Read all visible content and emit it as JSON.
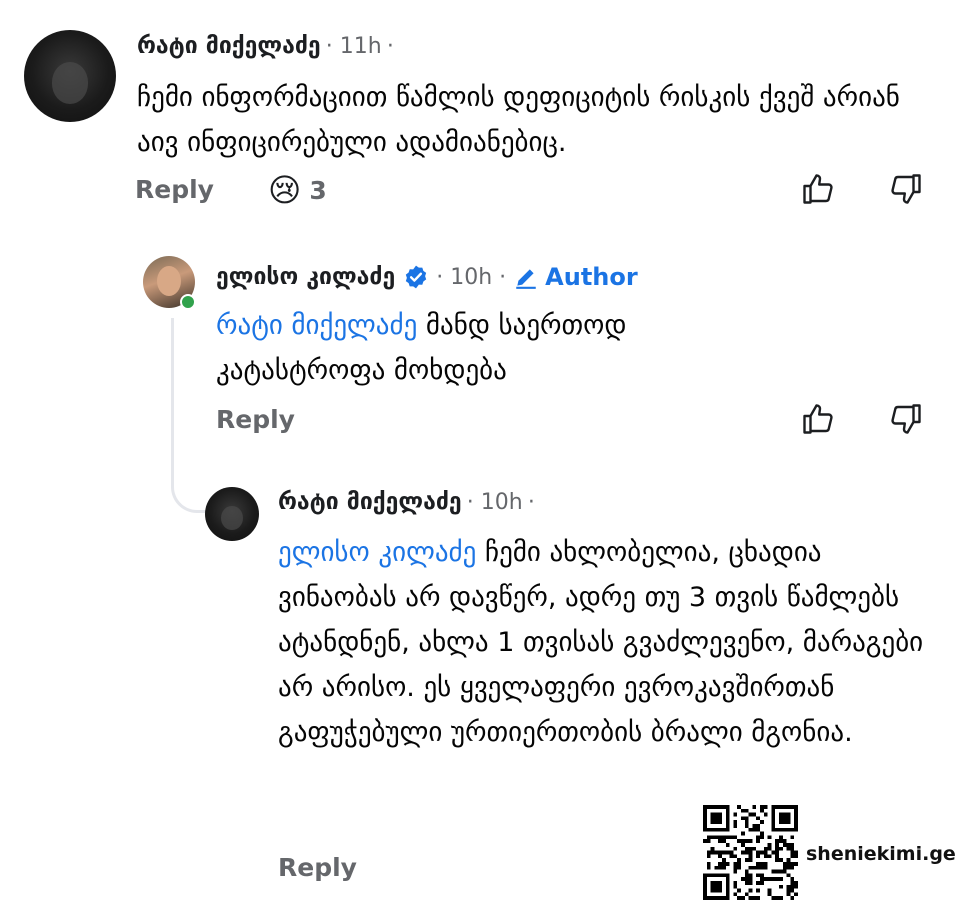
{
  "comments": [
    {
      "author": "რატი მიქელაძე",
      "time": "11h",
      "text": "ჩემი ინფორმაციით წამლის დეფიციტის რისკის ქვეშ არიან აივ ინფიცირებული ადამიანებიც.",
      "reply_label": "Reply",
      "reaction_emoji": "😢",
      "reaction_count": "3"
    },
    {
      "author": "ელისო კილაძე",
      "time": "10h",
      "badge_label": "Author",
      "mention": "რატი მიქელაძე",
      "text": "მანდ საერთოდ კატასტროფა მოხდება",
      "reply_label": "Reply"
    },
    {
      "author": "რატი მიქელაძე",
      "time": "10h",
      "mention": "ელისო კილაძე",
      "text": "ჩემი ახლობელია, ცხადია ვინაობას არ დავწერ, ადრე თუ 3 თვის წამლებს ატანდნენ, ახლა 1 თვისას გვაძლევენო, მარაგები არ არისო. ეს ყველაფერი ევროკავშირთან გაფუჭებული ურთიერთობის ბრალი მგონია.",
      "reply_label": "Reply"
    }
  ],
  "watermark": {
    "site": "sheniekimi.ge"
  },
  "icons": {
    "like": "thumbs-up-icon",
    "dislike": "thumbs-down-icon",
    "verified": "verified-badge-icon",
    "pen": "pencil-icon"
  },
  "colors": {
    "link": "#1b74e4",
    "meta": "#65676b",
    "online": "#31a24c"
  }
}
